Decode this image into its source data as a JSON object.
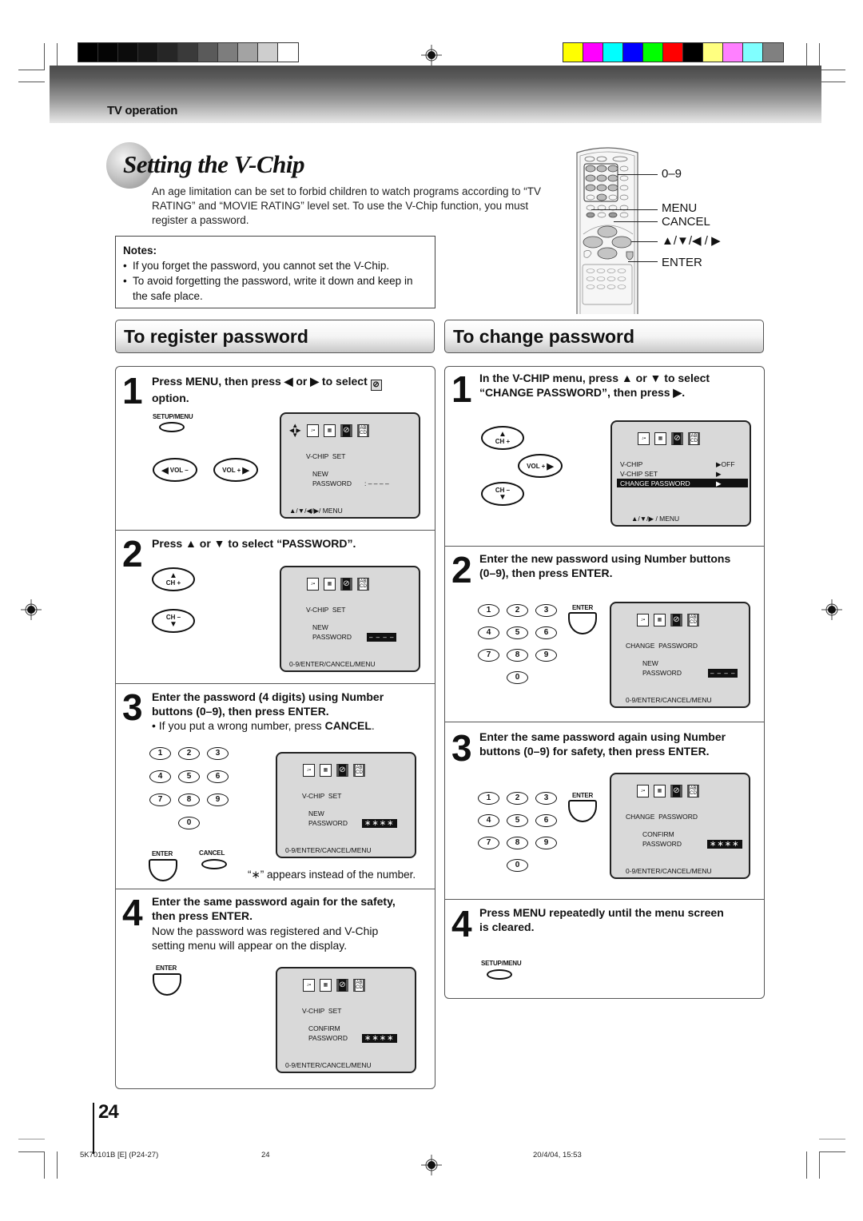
{
  "header": {
    "section": "TV operation",
    "gray_bars": [
      "#000000",
      "#050505",
      "#0c0c0c",
      "#161616",
      "#262626",
      "#3a3a3a",
      "#5a5a5a",
      "#7d7d7d",
      "#a3a3a3",
      "#cecece",
      "#ffffff"
    ],
    "color_bars": [
      "#ffff00",
      "#ff00ff",
      "#00ffff",
      "#0000ff",
      "#00ff00",
      "#ff0000",
      "#000000",
      "#ffff80",
      "#ff80ff",
      "#80ffff",
      "#808080"
    ]
  },
  "title": "Setting the V-Chip",
  "intro": "An age limitation can be set to forbid children to watch programs according to “TV RATING” and “MOVIE RATING” level set. To use the V-Chip function, you must register a password.",
  "notes": {
    "title": "Notes:",
    "items": [
      "If you forget the password, you cannot set the V-Chip.",
      "To avoid forgetting the password, write it down and keep in the safe place."
    ]
  },
  "remote": {
    "labels": [
      "0–9",
      "MENU",
      "CANCEL",
      "▲/▼/◀ / ▶",
      "ENTER"
    ]
  },
  "register": {
    "heading": "To register password",
    "steps": [
      {
        "num": "1",
        "text_a": "Press MENU, then press ◀ or ▶ to select",
        "text_b": "option.",
        "buttons": {
          "setup_menu": "SETUP/MENU",
          "vol_minus": "VOL –",
          "vol_plus": "VOL +"
        },
        "screen": {
          "title": "V-CHIP  SET",
          "line1": "NEW",
          "line2": "PASSWORD",
          "value": ": – – – –",
          "hint": "▲/▼/◀/▶/ MENU"
        }
      },
      {
        "num": "2",
        "text": "Press ▲ or ▼ to select “PASSWORD”.",
        "buttons": {
          "ch_plus": "CH +",
          "ch_minus": "CH –"
        },
        "screen": {
          "title": "V-CHIP  SET",
          "line1": "NEW",
          "line2": "PASSWORD",
          "value": "– – – –",
          "hint": "0-9/ENTER/CANCEL/MENU"
        }
      },
      {
        "num": "3",
        "text_a": "Enter the password (4 digits) using Number",
        "text_b": "buttons (0–9), then press ENTER.",
        "sub_a": "• If you put a wrong number, press ",
        "sub_b": "CANCEL",
        "sub_c": ".",
        "numbers": [
          "1",
          "2",
          "3",
          "4",
          "5",
          "6",
          "7",
          "8",
          "9",
          "0"
        ],
        "buttons": {
          "enter": "ENTER",
          "cancel": "CANCEL"
        },
        "screen": {
          "title": "V-CHIP  SET",
          "line1": "NEW",
          "line2": "PASSWORD",
          "value": "∗∗∗∗",
          "hint": "0-9/ENTER/CANCEL/MENU"
        },
        "footnote": "“∗” appears instead of the number."
      },
      {
        "num": "4",
        "text_a": "Enter the same password again for the safety,",
        "text_b": "then press ENTER.",
        "sub_a": "Now the password was registered and V-Chip",
        "sub_b": "setting menu will appear on the display.",
        "buttons": {
          "enter": "ENTER"
        },
        "screen": {
          "title": "V-CHIP  SET",
          "line1": "CONFIRM",
          "line2": "PASSWORD",
          "value": "∗∗∗∗",
          "hint": "0-9/ENTER/CANCEL/MENU"
        }
      }
    ]
  },
  "change": {
    "heading": "To change password",
    "steps": [
      {
        "num": "1",
        "text_a": "In the V-CHIP menu, press ▲ or ▼ to select",
        "text_b": "“CHANGE PASSWORD”, then press ▶.",
        "buttons": {
          "ch_plus": "CH +",
          "vol_plus": "VOL +",
          "ch_minus": "CH –"
        },
        "screen": {
          "rows": [
            {
              "label": "V-CHIP",
              "value": "▶OFF"
            },
            {
              "label": "V-CHIP SET",
              "value": "▶"
            },
            {
              "label": "CHANGE PASSWORD",
              "value": "▶"
            }
          ],
          "hint": "▲/▼/▶ / MENU"
        }
      },
      {
        "num": "2",
        "text_a": "Enter the new password using Number buttons",
        "text_b": "(0–9), then press ENTER.",
        "numbers": [
          "1",
          "2",
          "3",
          "4",
          "5",
          "6",
          "7",
          "8",
          "9",
          "0"
        ],
        "buttons": {
          "enter": "ENTER"
        },
        "screen": {
          "title": "CHANGE  PASSWORD",
          "line1": "NEW",
          "line2": "PASSWORD",
          "value": "– – – –",
          "hint": "0-9/ENTER/CANCEL/MENU"
        }
      },
      {
        "num": "3",
        "text_a": "Enter the same password again using Number",
        "text_b": "buttons (0–9) for safety, then press ENTER.",
        "numbers": [
          "1",
          "2",
          "3",
          "4",
          "5",
          "6",
          "7",
          "8",
          "9",
          "0"
        ],
        "buttons": {
          "enter": "ENTER"
        },
        "screen": {
          "title": "CHANGE  PASSWORD",
          "line1": "CONFIRM",
          "line2": "PASSWORD",
          "value": "∗∗∗∗",
          "hint": "0-9/ENTER/CANCEL/MENU"
        }
      },
      {
        "num": "4",
        "text_a": "Press MENU repeatedly until the menu screen",
        "text_b": "is cleared.",
        "buttons": {
          "setup_menu": "SETUP/MENU"
        }
      }
    ]
  },
  "screen_icons": {
    "abcd": "AB CD",
    "lock": "⊘"
  },
  "page_number": "24",
  "footer": {
    "code": "5K70101B [E] (P24-27)",
    "page": "24",
    "date": "20/4/04, 15:53"
  }
}
